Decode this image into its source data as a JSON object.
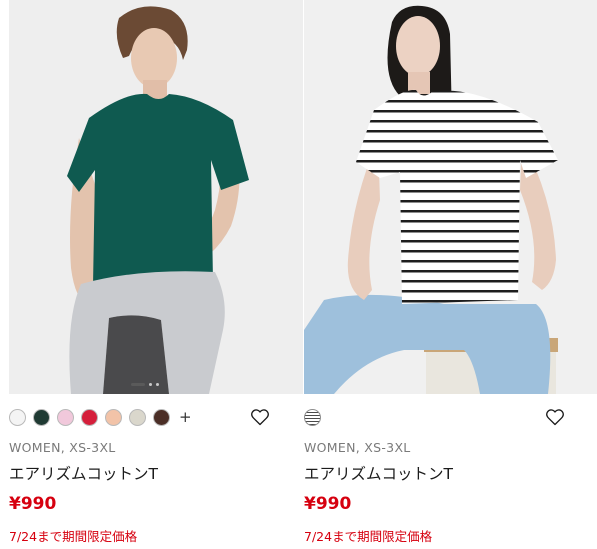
{
  "products": [
    {
      "image_label": "Woman in dark green short-sleeve T-shirt with grey sweater tied around waist",
      "colors": [
        "#f4f4f4",
        "#1f3a33",
        "#f1c8db",
        "#d51f3b",
        "#f2c3a8",
        "#dad7cc",
        "#4b2e26"
      ],
      "more_colors": "+",
      "meta": "WOMEN, XS-3XL",
      "name": "エアリズムコットンT",
      "price": "¥990",
      "promo": "7/24まで期間限定価格",
      "carousel_active": 1,
      "carousel_total": 3
    },
    {
      "image_label": "Woman in white and black striped T-shirt and light blue jeans",
      "pattern": "stripe",
      "meta": "WOMEN, XS-3XL",
      "name": "エアリズムコットンT",
      "price": "¥990",
      "promo": "7/24まで期間限定価格"
    }
  ],
  "icons": {
    "favorite": "heart-outline-icon",
    "pattern": "striped-swatch-icon"
  }
}
